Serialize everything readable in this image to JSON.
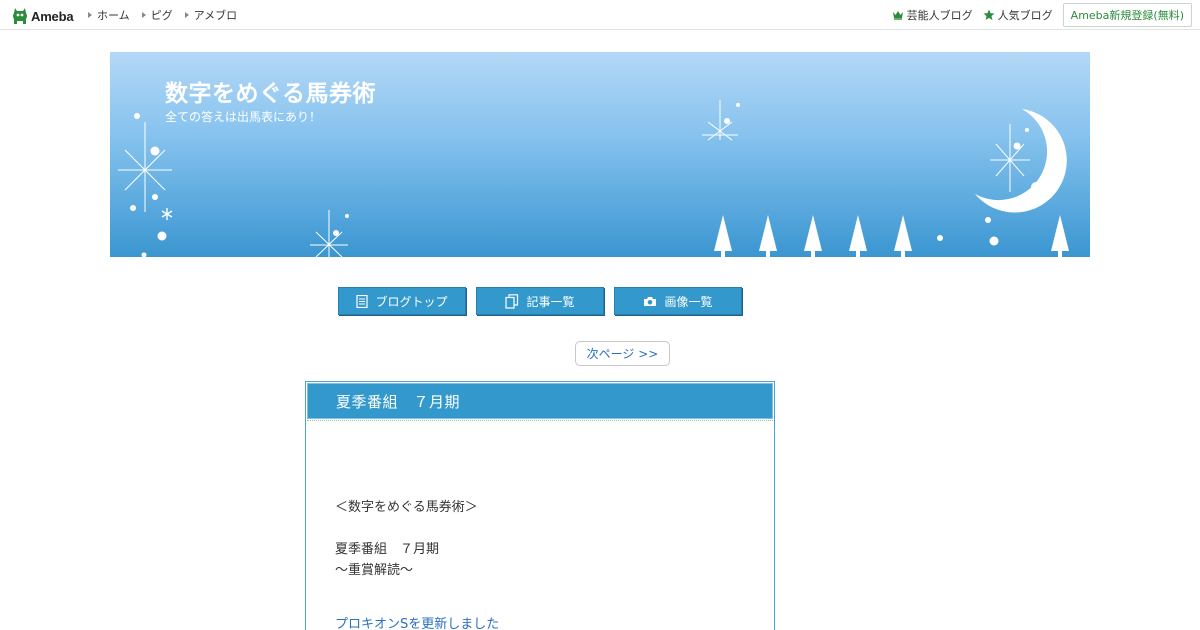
{
  "topbar": {
    "logo_text": "Ameba",
    "nav": [
      {
        "label": "ホーム"
      },
      {
        "label": "ピグ"
      },
      {
        "label": "アメブロ"
      }
    ],
    "right": [
      {
        "label": "芸能人ブログ",
        "icon": "crown-icon"
      },
      {
        "label": "人気ブログ",
        "icon": "star-icon"
      }
    ],
    "register_label": "Ameba新規登録(無料)",
    "accent_color": "#2d8c3c"
  },
  "header": {
    "title": "数字をめぐる馬券術",
    "description": "全ての答えは出馬表にあり！"
  },
  "blog_nav": [
    {
      "label": "ブログトップ",
      "icon": "document-icon"
    },
    {
      "label": "記事一覧",
      "icon": "copy-icon"
    },
    {
      "label": "画像一覧",
      "icon": "camera-icon"
    }
  ],
  "pagination": {
    "next_label": "次ページ >>"
  },
  "article": {
    "title": "夏季番組　７月期",
    "body": {
      "line1": "＜数字をめぐる馬券術＞",
      "line2": "夏季番組　７月期",
      "line3": "～重賞解読～",
      "link": "プロキオンSを更新しました"
    },
    "theme_color": "#3399cc"
  }
}
